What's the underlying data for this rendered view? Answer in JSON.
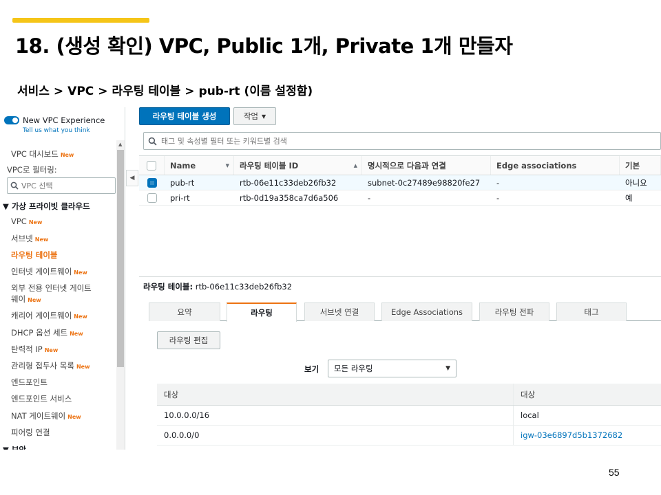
{
  "slide": {
    "title": "18. (생성 확인) VPC, Public 1개, Private 1개 만들자",
    "breadcrumb": [
      "서비스",
      "VPC",
      "라우팅 테이블",
      "pub-rt (이름 설정함)"
    ],
    "breadcrumb_sep": ">",
    "page_number": "55",
    "accent_color": "#f5c518"
  },
  "sidebar": {
    "new_vpc_experience": "New VPC Experience",
    "tell_us": "Tell us what you think",
    "dashboard": "VPC 대시보드",
    "new_badge": "New",
    "filter_label": "VPC로 필터링:",
    "filter_placeholder": "VPC 선택",
    "section_title": "▼ 가상 프라이빗 클라우드",
    "items": [
      {
        "label": "VPC",
        "badge": "New"
      },
      {
        "label": "서브넷",
        "badge": "New"
      },
      {
        "label": "라우팅 테이블",
        "badge": ""
      },
      {
        "label": "인터넷 게이트웨이",
        "badge": "New"
      },
      {
        "label": "외부 전용 인터넷 게이트",
        "label2": "웨이",
        "badge": "New"
      },
      {
        "label": "캐리어 게이트웨이",
        "badge": "New"
      },
      {
        "label": "DHCP 옵션 세트",
        "badge": "New"
      },
      {
        "label": "탄력적 IP",
        "badge": "New"
      },
      {
        "label": "관리형 접두사 목록",
        "badge": "New"
      },
      {
        "label": "엔드포인트",
        "badge": ""
      },
      {
        "label": "엔드포인트 서비스",
        "badge": ""
      },
      {
        "label": "NAT 게이트웨이",
        "badge": "New"
      },
      {
        "label": "피어링 연결",
        "badge": ""
      }
    ],
    "next_section": "▼ 보안"
  },
  "toolbar": {
    "create_button": "라우팅 테이블 생성",
    "actions_button": "작업",
    "search_placeholder": "태그 및 속성별 필터 또는 키워드별 검색"
  },
  "table": {
    "columns": [
      "Name",
      "라우팅 테이블 ID",
      "명시적으로 다음과 연결",
      "Edge associations",
      "기본"
    ],
    "rows": [
      {
        "selected": true,
        "name": "pub-rt",
        "id": "rtb-06e11c33deb26fb32",
        "explicit": "subnet-0c27489e98820fe27",
        "edge": "-",
        "main": "아니요"
      },
      {
        "selected": false,
        "name": "pri-rt",
        "id": "rtb-0d19a358ca7d6a506",
        "explicit": "-",
        "edge": "-",
        "main": "예"
      }
    ]
  },
  "detail": {
    "label": "라우팅 테이블:",
    "value": "rtb-06e11c33deb26fb32",
    "tabs": [
      "요약",
      "라우팅",
      "서브넷 연결",
      "Edge Associations",
      "라우팅 전파",
      "태그"
    ],
    "active_tab": 1,
    "edit_button": "라우팅 편집",
    "view_label": "보기",
    "view_select": "모든 라우팅",
    "routes_columns": [
      "대상",
      "대상"
    ],
    "routes": [
      {
        "destination": "10.0.0.0/16",
        "target": "local"
      },
      {
        "destination": "0.0.0.0/0",
        "target": "igw-03e6897d5b1372682"
      }
    ]
  }
}
